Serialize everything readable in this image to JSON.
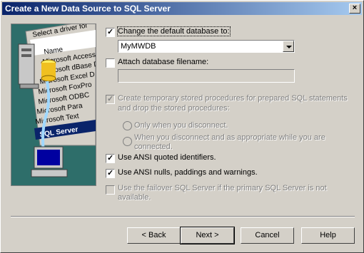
{
  "window": {
    "title": "Create a New Data Source to SQL Server"
  },
  "art": {
    "header_text": "Select a driver for",
    "list_items": [
      "Name",
      "Microsoft Access D",
      "Microsoft dBase D",
      "Microsoft Excel D",
      "Microsoft FoxPro",
      "Microsoft ODBC",
      "Microsoft Para",
      "Microsoft Text",
      "SQL Server"
    ]
  },
  "options": {
    "change_default_db": {
      "label": "Change the default database to:",
      "checked": true
    },
    "database_value": "MyMWDB",
    "attach_db": {
      "label": "Attach database filename:",
      "checked": false
    },
    "attach_value": "",
    "create_temp_sp": {
      "line1": "Create temporary stored procedures for prepared SQL statements",
      "line2": "and drop the stored procedures:",
      "checked": true,
      "enabled": false
    },
    "radio_disconnect": {
      "label": "Only when you disconnect."
    },
    "radio_appropriate": {
      "line1": "When you disconnect and as appropriate while you are",
      "line2": "connected."
    },
    "ansi_quoted": {
      "label": "Use ANSI quoted identifiers.",
      "checked": true
    },
    "ansi_nulls": {
      "label": "Use ANSI nulls, paddings and warnings.",
      "checked": true
    },
    "failover": {
      "line1": "Use the failover SQL Server if the primary SQL Server is not",
      "line2": "available.",
      "checked": false,
      "enabled": false
    }
  },
  "buttons": {
    "back": "< Back",
    "next": "Next >",
    "cancel": "Cancel",
    "help": "Help"
  },
  "colors": {
    "title_start": "#0a246a",
    "title_end": "#a6caf0",
    "face": "#d4d0c8"
  }
}
